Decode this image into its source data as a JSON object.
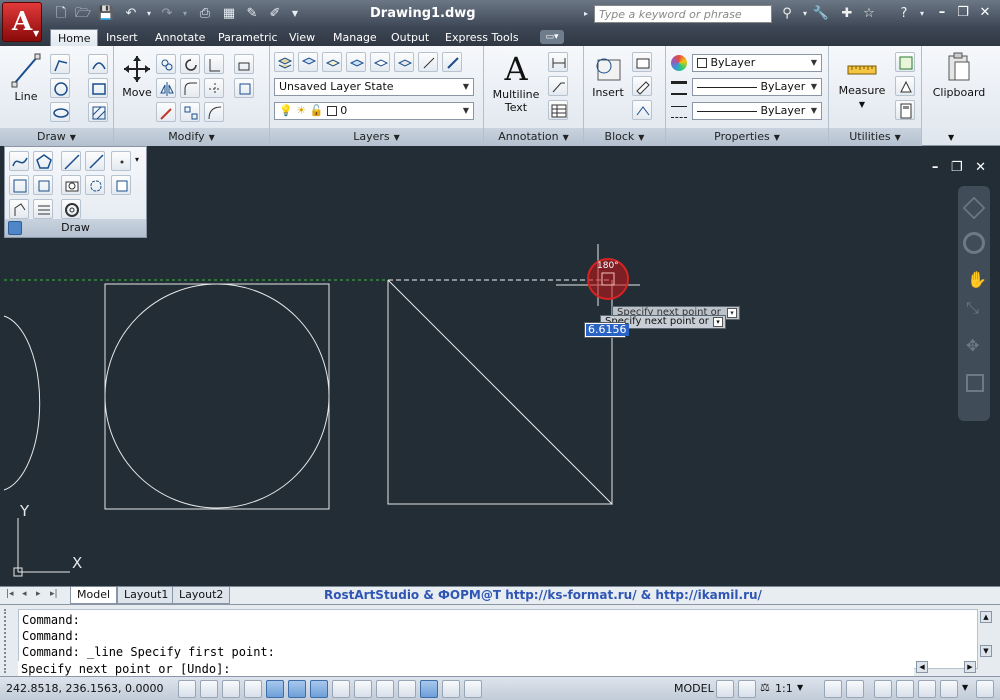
{
  "titlebar": {
    "doc_title": "Drawing1.dwg",
    "search_placeholder": "Type a keyword or phrase"
  },
  "tabs": [
    "Home",
    "Insert",
    "Annotate",
    "Parametric",
    "View",
    "Manage",
    "Output",
    "Express Tools"
  ],
  "ribbon": {
    "draw": {
      "line_label": "Line",
      "title": "Draw"
    },
    "modify": {
      "move_label": "Move",
      "title": "Modify"
    },
    "layers": {
      "layer_state": "Unsaved Layer State",
      "current_layer": "0",
      "title": "Layers"
    },
    "annotation": {
      "text_label_1": "Multiline",
      "text_label_2": "Text",
      "title": "Annotation"
    },
    "block": {
      "insert_label": "Insert",
      "title": "Block"
    },
    "properties": {
      "color": "ByLayer",
      "linetype": "ByLayer",
      "lineweight": "ByLayer",
      "title": "Properties"
    },
    "utilities": {
      "measure_label": "Measure",
      "title": "Utilities"
    },
    "clipboard": {
      "label": "Clipboard"
    }
  },
  "canvas": {
    "tooltip_prompt": "Specify next point or",
    "dynamic_input_value": "6.6156",
    "angle_tooltip": "180°",
    "ucs_x": "X",
    "ucs_y": "Y"
  },
  "layout_tabs": [
    "Model",
    "Layout1",
    "Layout2"
  ],
  "watermark": "RostArtStudio & ФОРМ@Т http://ks-format.ru/ & http://ikamil.ru/",
  "command": {
    "history": [
      "Command:",
      "Command:",
      "Command: _line Specify first point:"
    ],
    "prompt": "Specify next point or [Undo]:"
  },
  "status": {
    "coordinates": "242.8518, 236.1563, 0.0000",
    "model": "MODEL",
    "scale": "1:1"
  },
  "colors": {
    "canvas_bg": "#222d36",
    "accent_red": "#c01414",
    "watermark_blue": "#2f56b3"
  }
}
